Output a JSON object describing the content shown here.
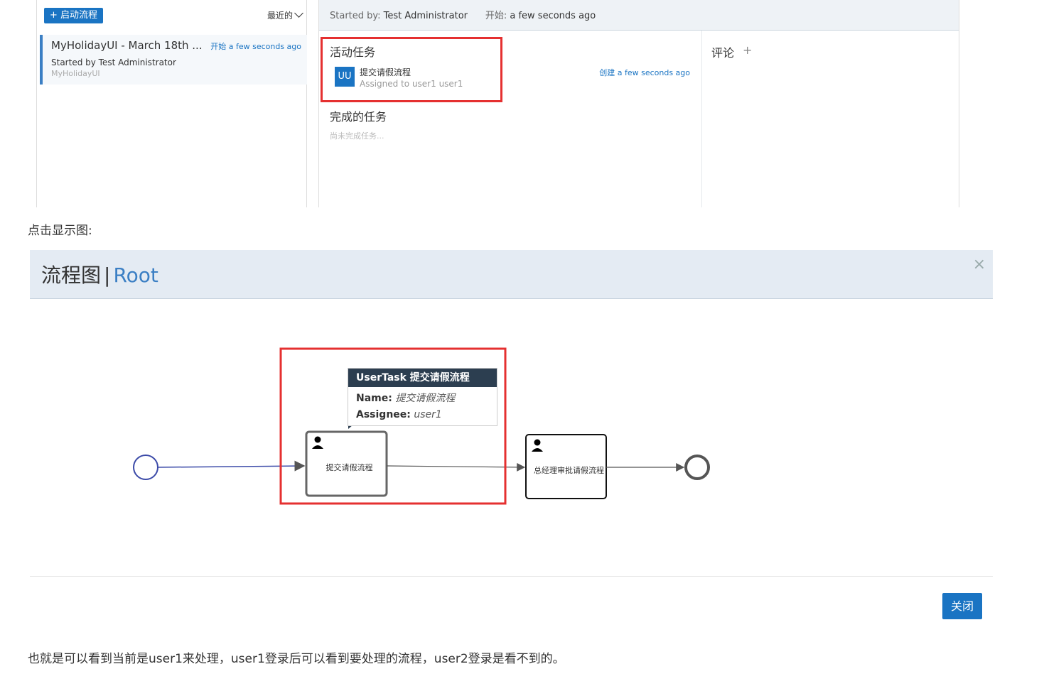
{
  "process_list": {
    "start_button": "+ 启动流程",
    "sort_label": "最近的",
    "item": {
      "title": "MyHolidayUI - March 18th ...",
      "time": "开始 a few seconds ago",
      "started_by": "Started by Test Administrator",
      "definition": "MyHolidayUI"
    }
  },
  "process_detail": {
    "started_by_label": "Started by:",
    "started_by_value": "Test Administrator",
    "start_label": "开始:",
    "start_value": "a few seconds ago",
    "active_tasks_title": "活动任务",
    "task": {
      "badge": "UU",
      "name": "提交请假流程",
      "assigned": "Assigned to user1 user1",
      "created": "创建 a few seconds ago"
    },
    "completed_tasks_title": "完成的任务",
    "completed_empty": "尚未完成任务...",
    "comments_title": "评论",
    "comments_add": "+"
  },
  "caption": "点击显示图:",
  "modal": {
    "title": "流程图",
    "separator": "|",
    "subtitle": "Root",
    "close_x": "×",
    "close_button": "关闭"
  },
  "diagram": {
    "tooltip": {
      "header": "UserTask 提交请假流程",
      "name_label": "Name:",
      "name_value": "提交请假流程",
      "assignee_label": "Assignee:",
      "assignee_value": "user1"
    },
    "task1_label": "提交请假流程",
    "task2_label": "总经理审批请假流程"
  },
  "bottom_text": "也就是可以看到当前是user1来处理，user1登录后可以看到要处理的流程，user2登录是看不到的。",
  "colors": {
    "accent": "#1a74c3",
    "highlight_red": "#e53030",
    "header_bg": "#e4ebf3",
    "flow_active": "#3b4aa8"
  }
}
